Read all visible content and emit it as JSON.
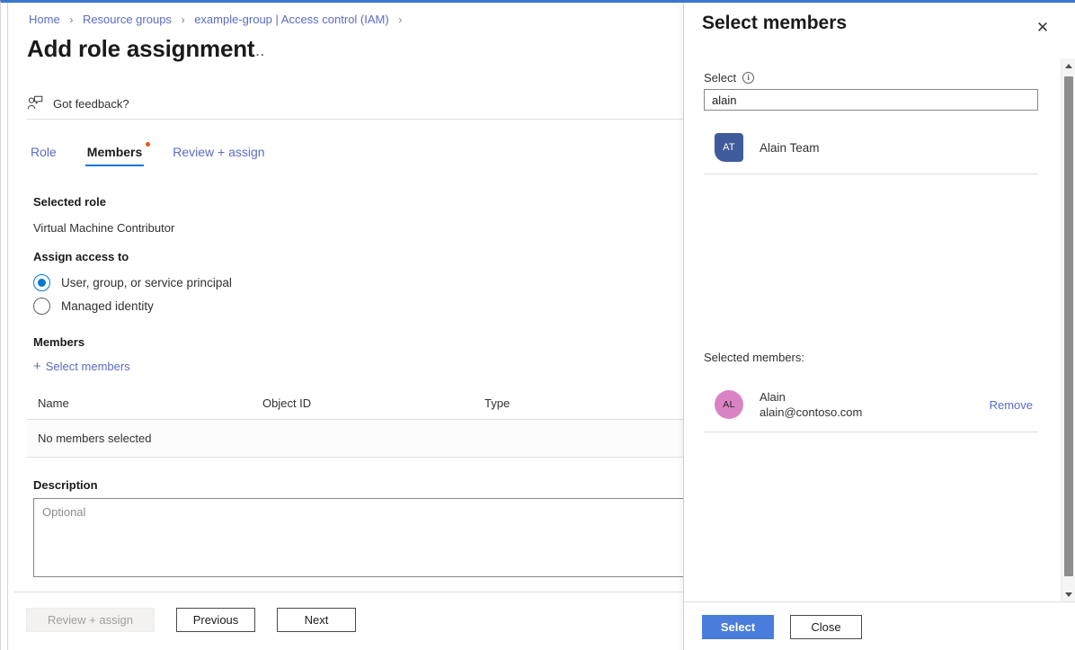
{
  "breadcrumb": {
    "items": [
      {
        "label": "Home"
      },
      {
        "label": "Resource groups"
      },
      {
        "label": "example-group | Access control (IAM)"
      }
    ],
    "separator": "›"
  },
  "page": {
    "title": "Add role assignment",
    "ellipsis": "…"
  },
  "feedback": {
    "label": "Got feedback?",
    "icon": "feedback-person-icon"
  },
  "tabs": [
    {
      "label": "Role",
      "active": false,
      "dot": false
    },
    {
      "label": "Members",
      "active": true,
      "dot": true
    },
    {
      "label": "Review + assign",
      "active": false,
      "dot": false
    }
  ],
  "selected_role": {
    "label": "Selected role",
    "value": "Virtual Machine Contributor"
  },
  "assign_access": {
    "label": "Assign access to",
    "options": [
      {
        "label": "User, group, or service principal",
        "checked": true
      },
      {
        "label": "Managed identity",
        "checked": false
      }
    ]
  },
  "members": {
    "label": "Members",
    "select_members_link": "Select members",
    "plus": "+",
    "table": {
      "columns": [
        "Name",
        "Object ID",
        "Type"
      ],
      "empty_text": "No members selected"
    }
  },
  "description": {
    "label": "Description",
    "placeholder": "Optional",
    "value": ""
  },
  "footer": {
    "review_assign": "Review + assign",
    "previous": "Previous",
    "next": "Next"
  },
  "panel": {
    "title": "Select members",
    "close_icon": "✕",
    "select_field": {
      "label": "Select",
      "info_icon": "i",
      "value": "alain",
      "placeholder": ""
    },
    "results": [
      {
        "initials": "AT",
        "name": "Alain Team",
        "avatar_color": "#3f5b9c",
        "avatar_shape": "square"
      }
    ],
    "selected_members_heading": "Selected members:",
    "selected_members": [
      {
        "initials": "AL",
        "name": "Alain",
        "email": "alain@contoso.com",
        "remove_label": "Remove",
        "avatar_color": "#d983c4",
        "avatar_shape": "circle"
      }
    ],
    "footer": {
      "select": "Select",
      "close": "Close"
    }
  },
  "colors": {
    "accent_blue": "#0078d4",
    "link_blue": "#5b6cc4",
    "primary_button": "#4a7ddb",
    "top_border": "#3b78cc",
    "dot_orange": "#e8561f"
  }
}
